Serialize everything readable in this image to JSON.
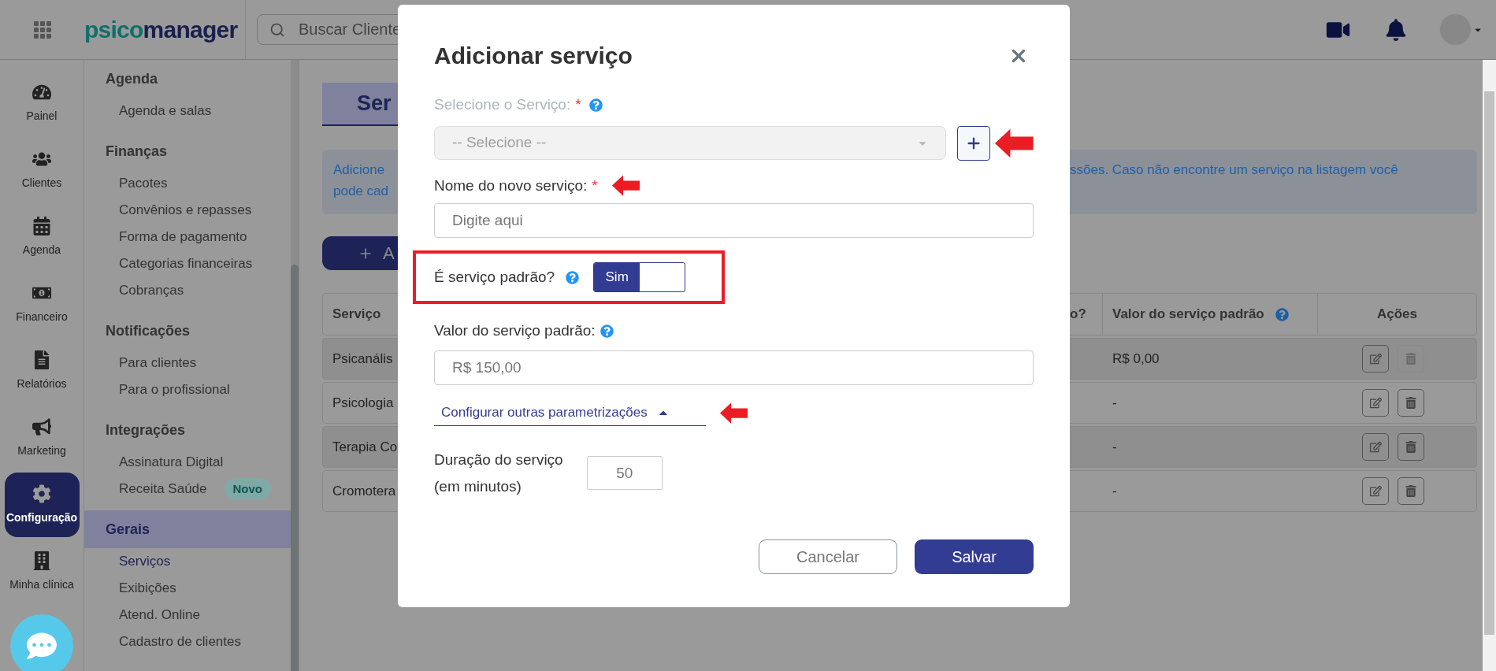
{
  "header": {
    "logo_first": "psico",
    "logo_second": "manager",
    "search_placeholder": "Buscar Cliente"
  },
  "rail": [
    {
      "label": "Painel",
      "selected": false
    },
    {
      "label": "Clientes",
      "selected": false
    },
    {
      "label": "Agenda",
      "selected": false
    },
    {
      "label": "Financeiro",
      "selected": false
    },
    {
      "label": "Relatórios",
      "selected": false
    },
    {
      "label": "Marketing",
      "selected": false
    },
    {
      "label": "Configuração",
      "selected": true
    },
    {
      "label": "Minha clínica",
      "selected": false
    }
  ],
  "menu": [
    {
      "title": "Agenda",
      "selected": false,
      "items": [
        {
          "label": "Agenda e salas",
          "selected": false
        }
      ]
    },
    {
      "title": "Finanças",
      "selected": false,
      "items": [
        {
          "label": "Pacotes",
          "selected": false
        },
        {
          "label": "Convênios e repasses",
          "selected": false
        },
        {
          "label": "Forma de pagamento",
          "selected": false
        },
        {
          "label": "Categorias financeiras",
          "selected": false
        },
        {
          "label": "Cobranças",
          "selected": false
        }
      ]
    },
    {
      "title": "Notificações",
      "selected": false,
      "items": [
        {
          "label": "Para clientes",
          "selected": false
        },
        {
          "label": "Para o profissional",
          "selected": false
        }
      ]
    },
    {
      "title": "Integrações",
      "selected": false,
      "items": [
        {
          "label": "Assinatura Digital",
          "selected": false
        },
        {
          "label": "Receita Saúde",
          "selected": false,
          "badge": "Novo"
        }
      ]
    },
    {
      "title": "Gerais",
      "selected": true,
      "items": [
        {
          "label": "Serviços",
          "selected": true
        },
        {
          "label": "Exibições",
          "selected": false
        },
        {
          "label": "Atend. Online",
          "selected": false
        },
        {
          "label": "Cadastro de clientes",
          "selected": false
        }
      ]
    }
  ],
  "page": {
    "title": "Ser",
    "info_left": [
      "Adicione",
      "pode cad"
    ],
    "info_right": "ssões. Caso não encontre um serviço na listagem você",
    "add_button": "A",
    "table": {
      "first_column": "Serviço",
      "columns": [
        "o?",
        "Valor do serviço padrão",
        "Ações"
      ],
      "rows": [
        {
          "name": "Psicanális",
          "value": "R$ 0,00",
          "delete_disabled": true
        },
        {
          "name": "Psicologia",
          "value": "-",
          "delete_disabled": false
        },
        {
          "name": "Terapia Co",
          "value": "-",
          "delete_disabled": false
        },
        {
          "name": "Cromotera",
          "value": "-",
          "delete_disabled": false
        }
      ]
    }
  },
  "modal": {
    "title": "Adicionar serviço",
    "select_label": "Selecione o Serviço:",
    "select_required": "*",
    "select_placeholder": "-- Selecione --",
    "name_label": "Nome do novo serviço:",
    "name_required": "*",
    "name_placeholder": "Digite aqui",
    "default_label": "É serviço padrão?",
    "default_on": true,
    "default_on_label": "Sim",
    "value_label": "Valor do serviço padrão:",
    "value": "R$ 150,00",
    "more_link": "Configurar outras parametrizações",
    "more_expanded": true,
    "duration_label": [
      "Duração do serviço",
      "(em minutos)"
    ],
    "duration": "50",
    "cancel": "Cancelar",
    "save": "Salvar"
  }
}
